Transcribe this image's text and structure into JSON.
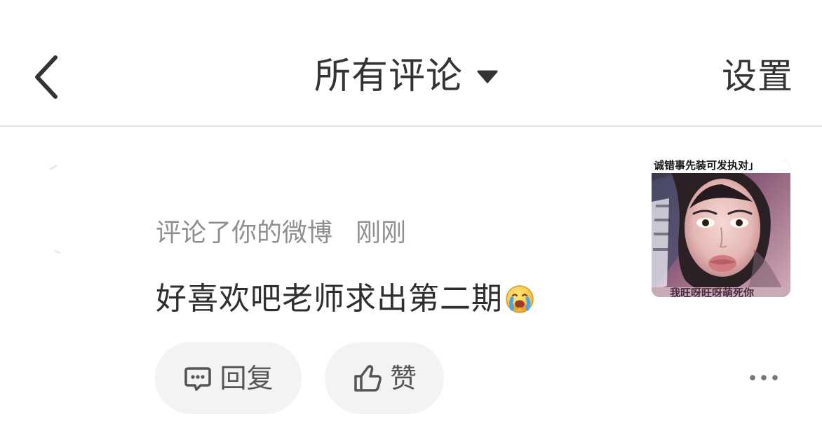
{
  "header": {
    "title": "所有评论",
    "settings_label": "设置"
  },
  "comment": {
    "meta_action": "评论了你的微博",
    "meta_time": "刚刚",
    "text": "好喜欢吧老师求出第二期"
  },
  "actions": {
    "reply_label": "回复",
    "like_label": "赞"
  },
  "thumbnail": {
    "top_text": "诚错事先装可发执对」",
    "bottom_text": "我旺呀旺呀萌死你"
  },
  "icons": {
    "back": "chevron-left-icon",
    "dropdown": "triangle-down-icon",
    "emoji": "crying-emoji-icon",
    "reply": "comment-icon",
    "like": "thumbs-up-icon",
    "more": "more-horizontal-icon"
  },
  "colors": {
    "background": "#ffffff",
    "primary_text": "#333333",
    "secondary_text": "#8f8f8f",
    "button_background": "#f3f3f3",
    "divider": "#e6e6e6",
    "icon": "#666666"
  }
}
